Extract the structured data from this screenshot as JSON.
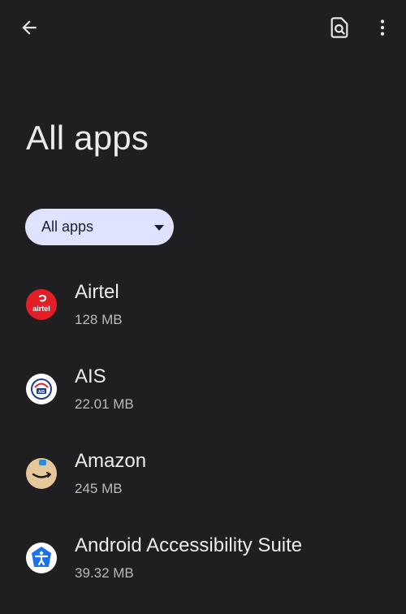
{
  "topbar": {
    "back_icon": "arrow-back-icon",
    "search_icon": "search-in-page-icon",
    "more_icon": "more-vert-icon"
  },
  "page": {
    "title": "All apps"
  },
  "filter": {
    "selected": "All apps"
  },
  "apps": [
    {
      "name": "Airtel",
      "size": "128 MB",
      "icon": "airtel-icon",
      "color": "#e41e26"
    },
    {
      "name": "AIS",
      "size": "22.01 MB",
      "icon": "ais-icon",
      "color": "#ffffff"
    },
    {
      "name": "Amazon",
      "size": "245 MB",
      "icon": "amazon-icon",
      "color": "#e6c79a"
    },
    {
      "name": "Android Accessibility Suite",
      "size": "39.32 MB",
      "icon": "accessibility-icon",
      "color": "#1a73e8"
    }
  ],
  "airtel_logo_text": "airtel",
  "ais_logo_text": "AIS"
}
